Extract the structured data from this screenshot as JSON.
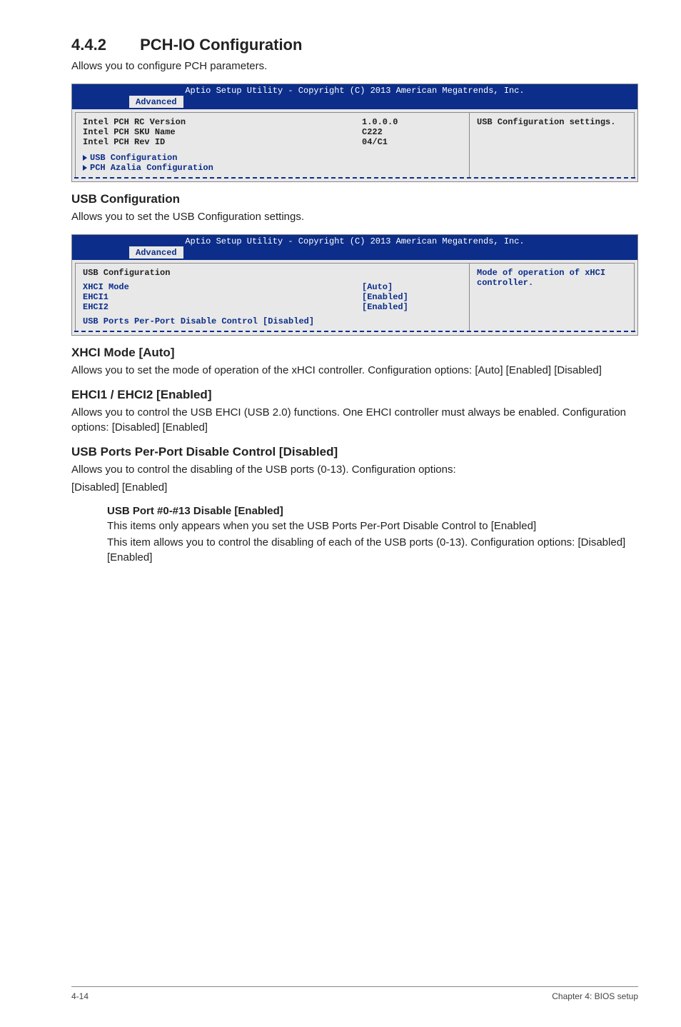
{
  "section": {
    "number": "4.4.2",
    "title": "PCH-IO Configuration",
    "intro": "Allows you to configure PCH parameters."
  },
  "bios1": {
    "header_line": "Aptio Setup Utility - Copyright (C) 2013 American Megatrends, Inc.",
    "tab": "Advanced",
    "rows": [
      {
        "k": "Intel PCH RC Version",
        "v": "1.0.0.0",
        "style": "bold"
      },
      {
        "k": "Intel PCH SKU Name",
        "v": "C222",
        "style": "bold"
      },
      {
        "k": "Intel PCH Rev ID",
        "v": "04/C1",
        "style": "bold"
      }
    ],
    "submenus": [
      "USB Configuration",
      "PCH Azalia Configuration"
    ],
    "help": "USB Configuration settings."
  },
  "usbconf": {
    "heading": "USB Configuration",
    "intro": "Allows you to set the USB Configuration settings."
  },
  "bios2": {
    "header_line": "Aptio Setup Utility - Copyright (C) 2013 American Megatrends, Inc.",
    "tab": "Advanced",
    "section_title": "USB Configuration",
    "rows": [
      {
        "k": "XHCI Mode",
        "v": "[Auto]",
        "style": "blue"
      },
      {
        "k": "",
        "v": "",
        "style": "blue"
      },
      {
        "k": "EHCI1",
        "v": "[Enabled]",
        "style": "blue"
      },
      {
        "k": "EHCI2",
        "v": "[Enabled]",
        "style": "blue"
      }
    ],
    "last_row": {
      "k": "USB Ports Per-Port Disable Control",
      "v": "[Disabled]"
    },
    "help": "Mode of operation of xHCI controller."
  },
  "xhci": {
    "heading": "XHCI Mode [Auto]",
    "text": "Allows you to set the mode of operation of the xHCI controller. Configuration options: [Auto] [Enabled] [Disabled]"
  },
  "ehci": {
    "heading": "EHCI1 / EHCI2 [Enabled]",
    "text": "Allows you to control the USB EHCI (USB 2.0) functions. One EHCI controller must always be enabled. Configuration options: [Disabled] [Enabled]"
  },
  "ppd": {
    "heading": "USB Ports Per-Port Disable Control [Disabled]",
    "text1": "Allows you to control the disabling of the USB ports (0-13). Configuration options:",
    "text2": "[Disabled] [Enabled]",
    "sub_heading": "USB Port #0-#13 Disable [Enabled]",
    "sub_text1": "This items only appears when you set the USB Ports Per-Port Disable Control to [Enabled]",
    "sub_text2": "This item allows you to control the disabling of each of the USB ports (0-13). Configuration options: [Disabled] [Enabled]"
  },
  "footer": {
    "left": "4-14",
    "right": "Chapter 4: BIOS setup"
  }
}
